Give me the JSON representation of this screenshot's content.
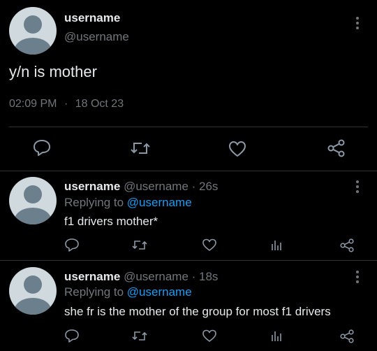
{
  "main_tweet": {
    "display_name": "username",
    "handle": "@username",
    "text": "y/n is mother",
    "time": "02:09 PM",
    "separator": "·",
    "date": "18 Oct 23"
  },
  "replies": [
    {
      "display_name": "username",
      "handle_time": "@username · 26s",
      "replying_prefix": "Replying to",
      "replying_to": "@username",
      "text": "f1 drivers mother*"
    },
    {
      "display_name": "username",
      "handle_time": "@username · 18s",
      "replying_prefix": "Replying to",
      "replying_to": "@username",
      "text": "she fr is the mother of the group for most f1 drivers"
    }
  ],
  "icons": {
    "reply": "reply-icon",
    "retweet": "retweet-icon",
    "like": "heart-icon",
    "views": "views-icon",
    "share": "share-icon",
    "more": "more-vertical-icon"
  },
  "colors": {
    "background": "#000000",
    "text": "#e7e9ea",
    "muted": "#71767b",
    "link": "#1d9bf0",
    "divider": "#2f3336"
  }
}
